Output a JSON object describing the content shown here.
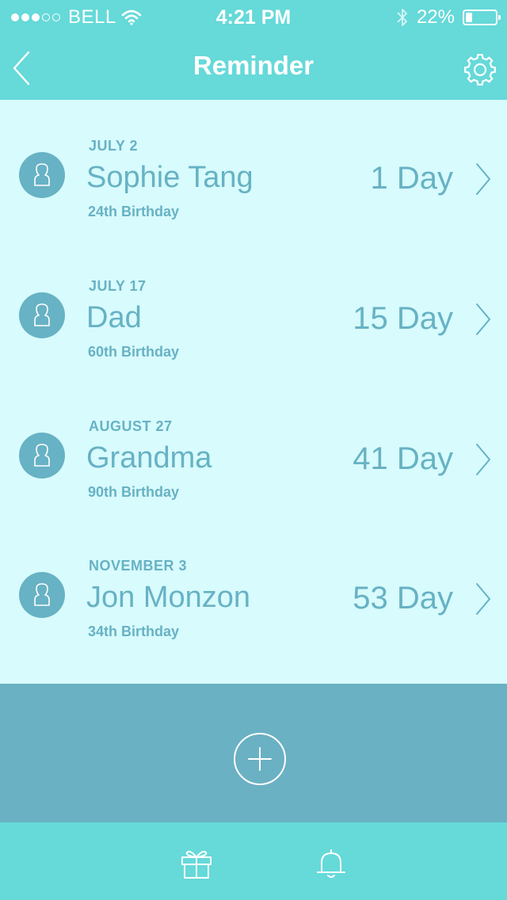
{
  "status_bar": {
    "carrier": "BELL",
    "time": "4:21 PM",
    "battery_percent": "22%",
    "battery_level": 0.22,
    "signal_filled": 3,
    "signal_total": 5,
    "icons": [
      "wifi-icon",
      "bluetooth-icon",
      "battery-icon"
    ]
  },
  "navbar": {
    "title": "Reminder",
    "back_icon": "chevron-left-icon",
    "settings_icon": "gear-icon"
  },
  "reminders": [
    {
      "date": "JULY 2",
      "name": "Sophie Tang",
      "occasion": "24th Birthday",
      "days": "1 Day"
    },
    {
      "date": "JULY 17",
      "name": "Dad",
      "occasion": "60th Birthday",
      "days": "15 Day"
    },
    {
      "date": "AUGUST 27",
      "name": "Grandma",
      "occasion": "90th Birthday",
      "days": "41 Day"
    },
    {
      "date": "NOVEMBER 3",
      "name": "Jon Monzon",
      "occasion": "34th Birthday",
      "days": "53 Day"
    }
  ],
  "add_button_icon": "plus-circle-icon",
  "tab_bar": {
    "tabs": [
      {
        "icon": "gift-icon"
      },
      {
        "icon": "bell-icon"
      }
    ]
  },
  "colors": {
    "header": "#66d9d9",
    "background": "#d8fbfd",
    "accent": "#67b2c4",
    "add_panel": "#6ab1c3",
    "text_on_header": "#ffffff"
  }
}
